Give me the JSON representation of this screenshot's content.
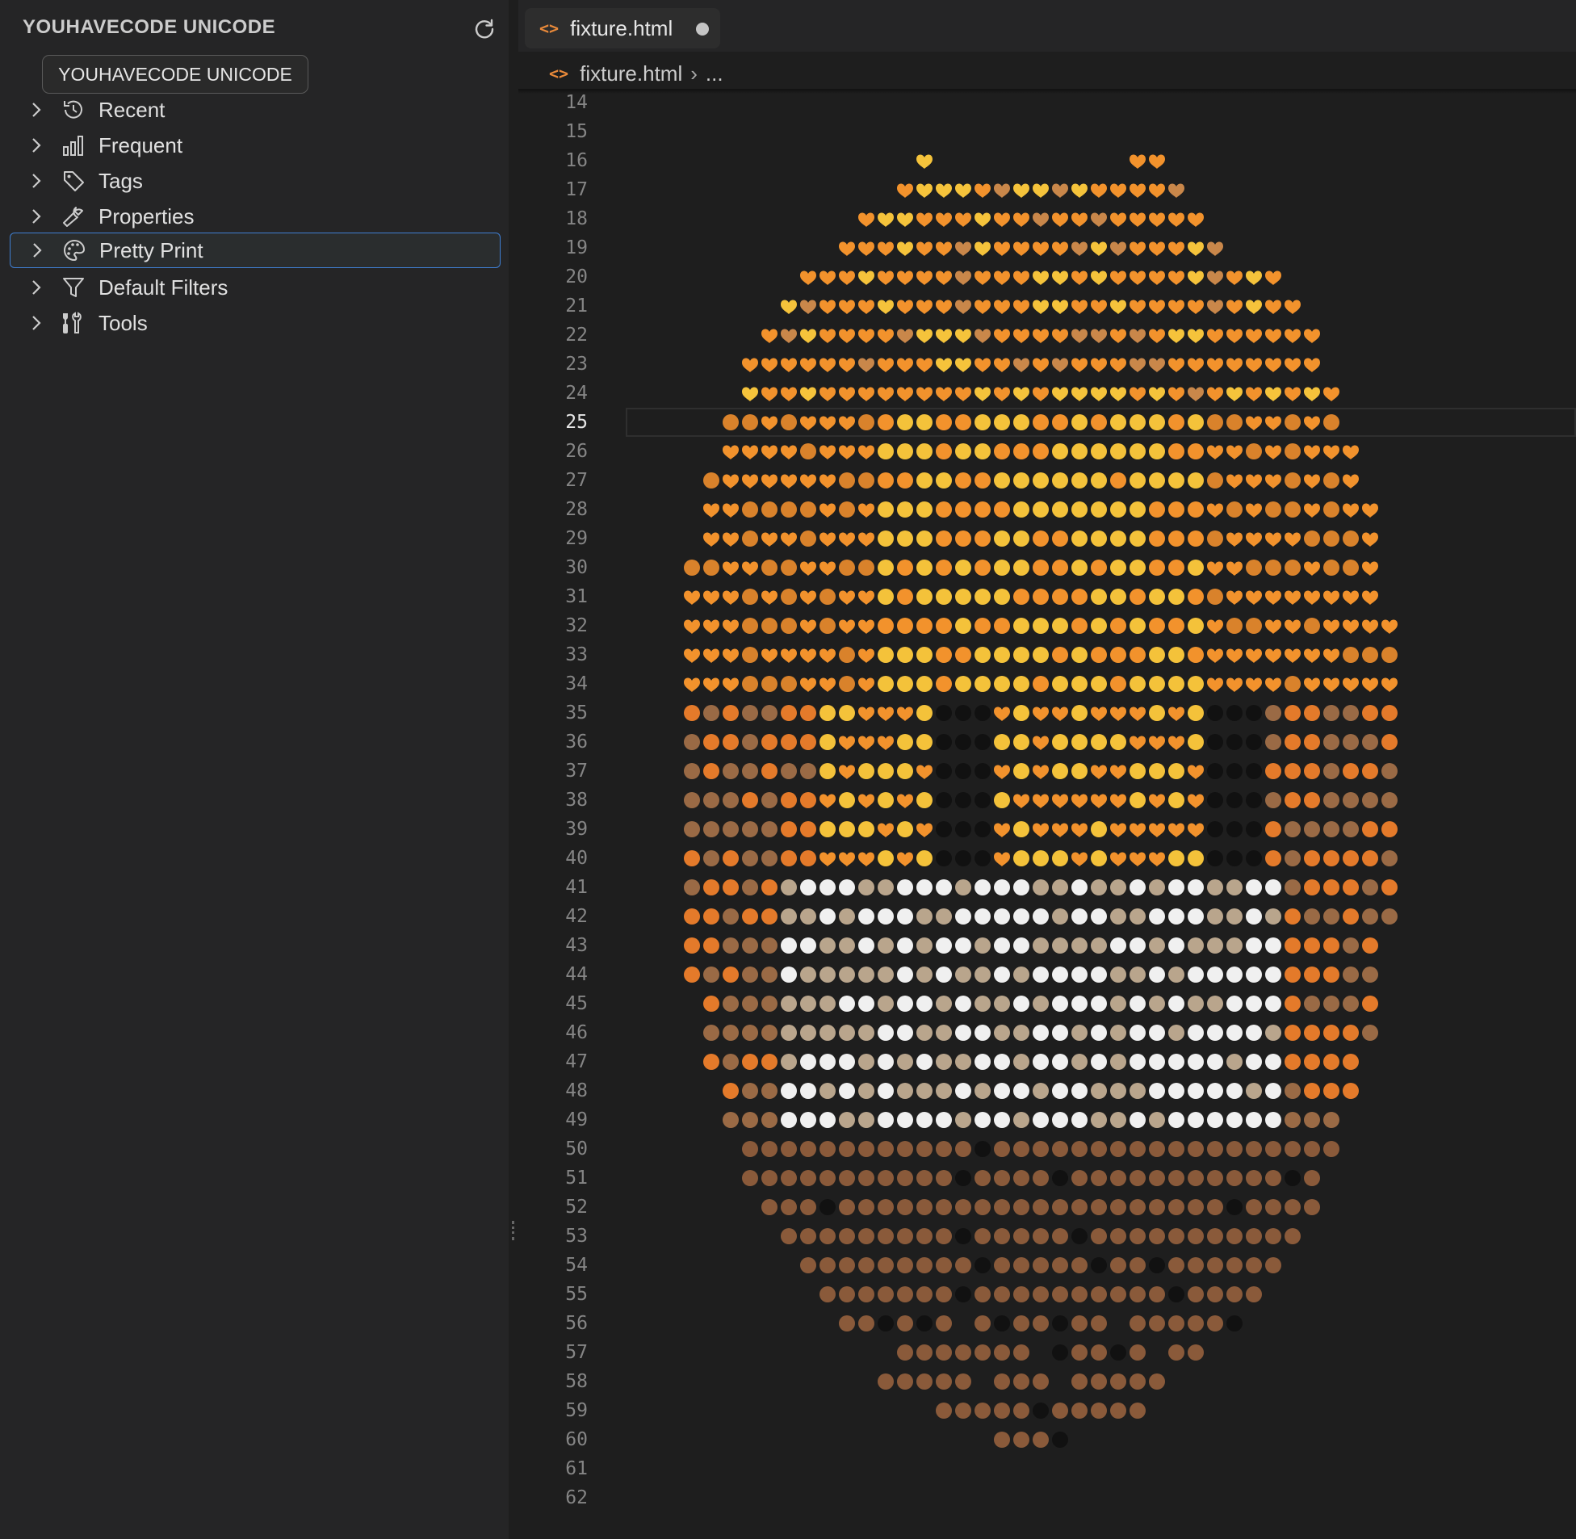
{
  "sidebar": {
    "title": "YOUHAVECODE UNICODE",
    "button_label": "YOUHAVECODE UNICODE",
    "items": [
      {
        "label": "Recent",
        "icon": "history-icon"
      },
      {
        "label": "Frequent",
        "icon": "bar-chart-icon"
      },
      {
        "label": "Tags",
        "icon": "tag-icon"
      },
      {
        "label": "Properties",
        "icon": "wrench-icon"
      },
      {
        "label": "Pretty Print",
        "icon": "palette-icon",
        "selected": true
      },
      {
        "label": "Default Filters",
        "icon": "filter-icon"
      },
      {
        "label": "Tools",
        "icon": "tools-icon"
      }
    ]
  },
  "editor": {
    "tab": {
      "name": "fixture.html",
      "dirty": true
    },
    "breadcrumb": {
      "file": "fixture.html",
      "more": "..."
    },
    "first_line": 14,
    "last_line": 62,
    "active_line": 25
  },
  "colors": {
    "accent": "#3f7fd3",
    "html_icon": "#e8893a",
    "editor_bg": "#1e1e1e",
    "sidebar_bg": "#252526"
  }
}
